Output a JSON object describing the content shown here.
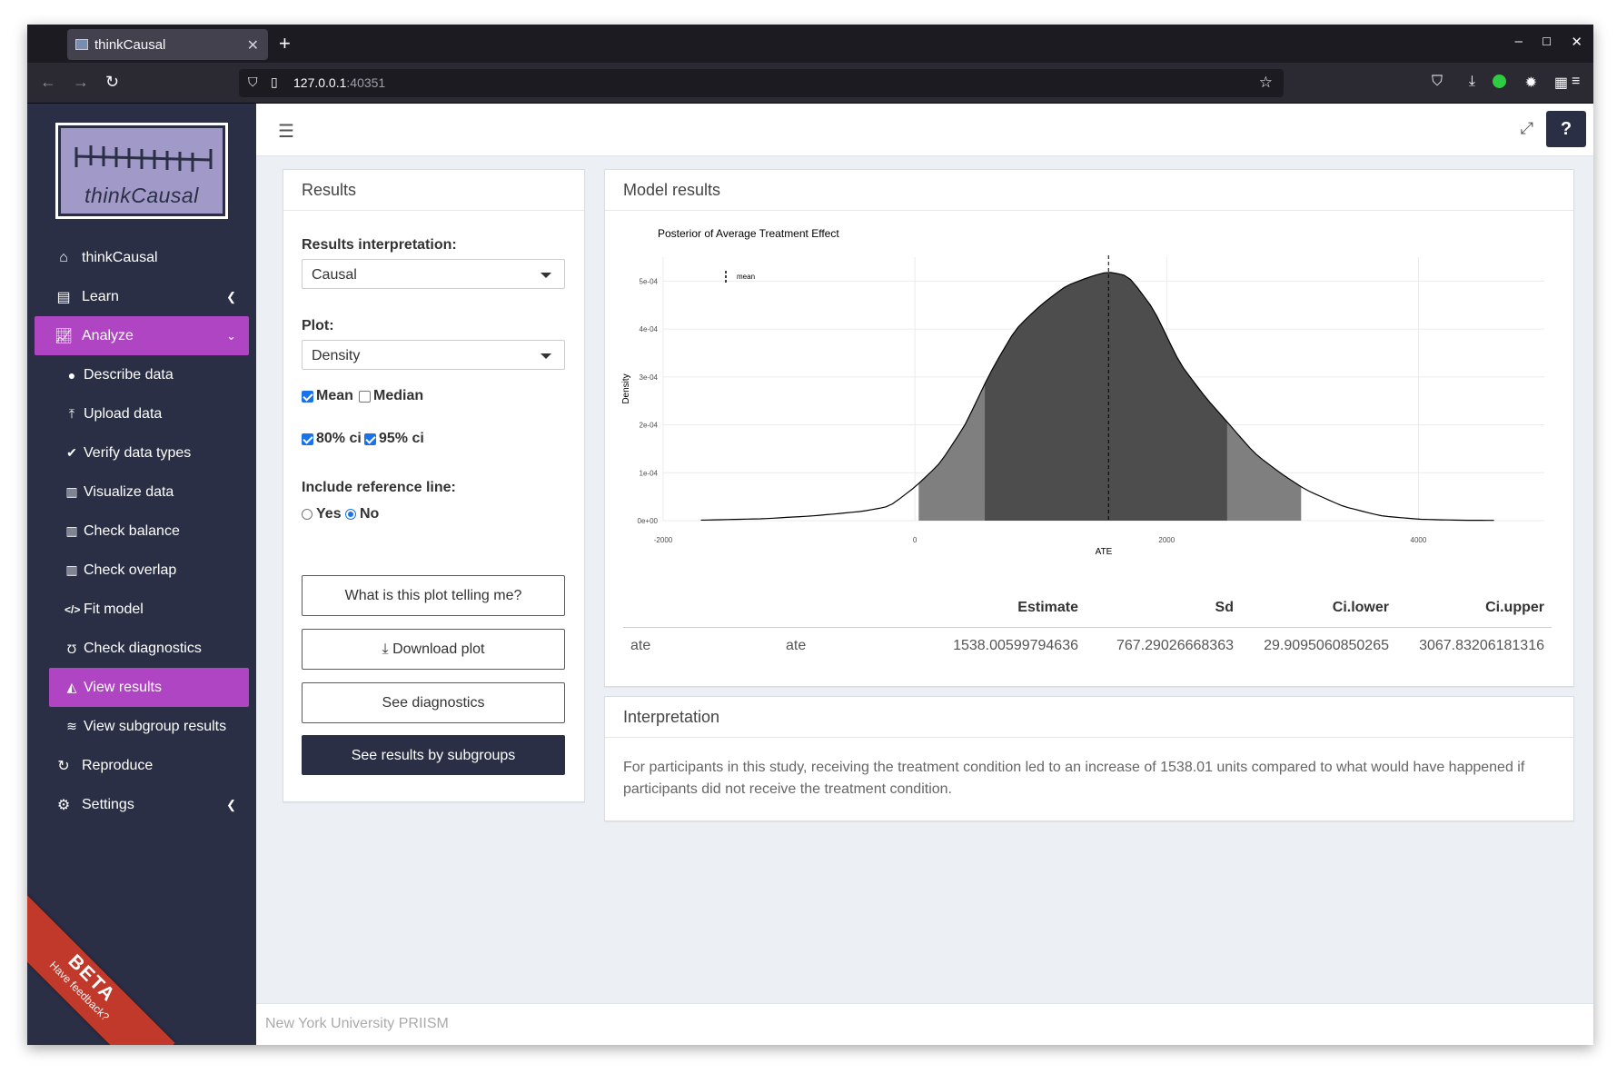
{
  "browser": {
    "tab_title": "thinkCausal",
    "url_host": "127.0.0.1",
    "url_port": ":40351"
  },
  "sidebar": {
    "logo_text_a": "think",
    "logo_text_b": "Causal",
    "items": [
      {
        "label": "thinkCausal",
        "icon": "home-icon"
      },
      {
        "label": "Learn",
        "icon": "book-icon"
      },
      {
        "label": "Analyze",
        "icon": "area-chart-icon"
      },
      {
        "label": "Reproduce",
        "icon": "redo-icon"
      },
      {
        "label": "Settings",
        "icon": "gear-icon"
      }
    ],
    "subitems": [
      {
        "label": "Describe data",
        "icon": "comment-icon"
      },
      {
        "label": "Upload data",
        "icon": "upload-icon"
      },
      {
        "label": "Verify data types",
        "icon": "check-icon"
      },
      {
        "label": "Visualize data",
        "icon": "bar-chart-icon"
      },
      {
        "label": "Check balance",
        "icon": "bar-chart-icon"
      },
      {
        "label": "Check overlap",
        "icon": "bar-chart-icon"
      },
      {
        "label": "Fit model",
        "icon": "code-icon"
      },
      {
        "label": "Check diagnostics",
        "icon": "stethoscope-icon"
      },
      {
        "label": "View results",
        "icon": "area-chart-icon"
      },
      {
        "label": "View subgroup results",
        "icon": "layers-icon"
      }
    ],
    "beta": "BETA",
    "beta_sub": "Have feedback?"
  },
  "results_panel": {
    "title": "Results",
    "interp_label": "Results interpretation:",
    "interp_value": "Causal",
    "plot_label": "Plot:",
    "plot_value": "Density",
    "mean_label": "Mean",
    "median_label": "Median",
    "ci80_label": "80% ci",
    "ci95_label": "95% ci",
    "refline_label": "Include reference line:",
    "yes_label": "Yes",
    "no_label": "No",
    "btn_telling": "What is this plot telling me?",
    "btn_download": "Download plot",
    "btn_diagnostics": "See diagnostics",
    "btn_subgroups": "See results by subgroups",
    "checked": {
      "mean": true,
      "median": false,
      "ci80": true,
      "ci95": true,
      "refline": "No"
    }
  },
  "model_panel": {
    "title": "Model results",
    "table": {
      "headers": [
        "Estimate",
        "Sd",
        "Ci.lower",
        "Ci.upper"
      ],
      "row": [
        "ate",
        "ate",
        "1538.00599794636",
        "767.29026668363",
        "29.9095060850265",
        "3067.83206181316"
      ]
    }
  },
  "interpretation": {
    "title": "Interpretation",
    "text": "For participants in this study, receiving the treatment condition led to an increase of 1538.01 units compared to what would have happened if participants did not receive the treatment condition."
  },
  "footer": "New York University PRIISM",
  "chart_data": {
    "type": "area",
    "title": "Posterior of Average Treatment Effect",
    "xlabel": "ATE",
    "ylabel": "Density",
    "xlim": [
      -2000,
      5000
    ],
    "ylim": [
      0,
      0.00055
    ],
    "x_ticks": [
      -2000,
      0,
      2000,
      4000
    ],
    "x_tick_labels": [
      "-2000",
      "0",
      "2000",
      "4000"
    ],
    "y_ticks": [
      0,
      0.0001,
      0.0002,
      0.0003,
      0.0004,
      0.0005
    ],
    "y_tick_labels": [
      "0e+00",
      "1e-04",
      "2e-04",
      "3e-04",
      "4e-04",
      "5e-04"
    ],
    "legend": [
      {
        "name": "mean",
        "style": "dashed"
      }
    ],
    "mean": 1538,
    "ci80": [
      555,
      2480
    ],
    "ci95": [
      30,
      3068
    ],
    "density": {
      "x": [
        -1700,
        -1200,
        -800,
        -400,
        -200,
        0,
        200,
        400,
        600,
        800,
        1000,
        1200,
        1400,
        1538,
        1700,
        1900,
        2100,
        2300,
        2500,
        2700,
        2900,
        3100,
        3400,
        3700,
        4000,
        4300,
        4600
      ],
      "y": [
        1e-06,
        4e-06,
        1e-05,
        2e-05,
        3e-05,
        7e-05,
        0.00012,
        0.0002,
        0.00031,
        0.0004,
        0.00045,
        0.00049,
        0.00051,
        0.00052,
        0.00051,
        0.00044,
        0.00033,
        0.00026,
        0.0002,
        0.00014,
        0.0001,
        6.5e-05,
        3e-05,
        1e-05,
        3e-06,
        1e-06,
        5e-07
      ]
    }
  }
}
